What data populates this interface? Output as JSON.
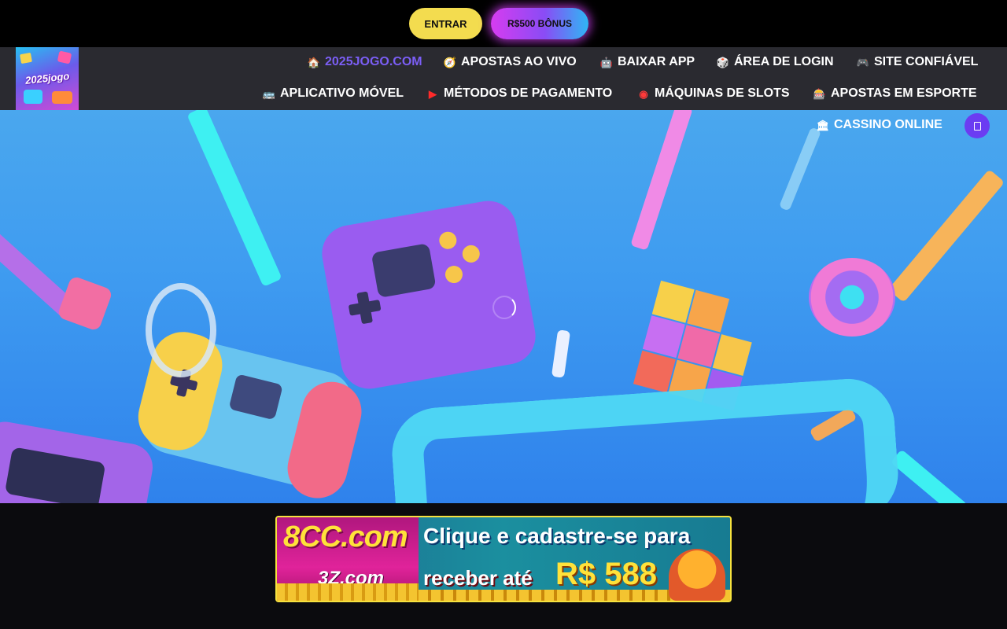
{
  "topbar": {
    "login_label": "ENTRAR",
    "bonus_label": "R$500 BÔNUS"
  },
  "logo": {
    "text": "2025jogo"
  },
  "nav": {
    "items": [
      {
        "label": "2025JOGO.COM",
        "icon": "house-icon",
        "active": true
      },
      {
        "label": "APOSTAS AO VIVO",
        "icon": "compass-icon"
      },
      {
        "label": "BAIXAR APP",
        "icon": "android-icon"
      },
      {
        "label": "ÁREA DE LOGIN",
        "icon": "dice-icon"
      },
      {
        "label": "SITE CONFIÁVEL",
        "icon": "gamepad-icon"
      },
      {
        "label": "APLICATIVO MÓVEL",
        "icon": "robot-icon"
      },
      {
        "label": "MÉTODOS DE PAGAMENTO",
        "icon": "youtube-icon"
      },
      {
        "label": "MÁQUINAS DE SLOTS",
        "icon": "chip-icon"
      },
      {
        "label": "APOSTAS EM ESPORTE",
        "icon": "slot-machine-icon"
      },
      {
        "label": "CASSINO ONLINE",
        "icon": "casino-icon"
      }
    ]
  },
  "banner": {
    "brand": "8CC.com",
    "brand2": "3Z.com",
    "line1": "Clique e cadastre-se para",
    "line2": "receber até",
    "amount": "R$ 588"
  },
  "colors": {
    "accent": "#6b3cf2",
    "login_button": "#f3dc4f",
    "nav_bg": "#2a2a30",
    "active_nav": "#7b5ef5"
  }
}
